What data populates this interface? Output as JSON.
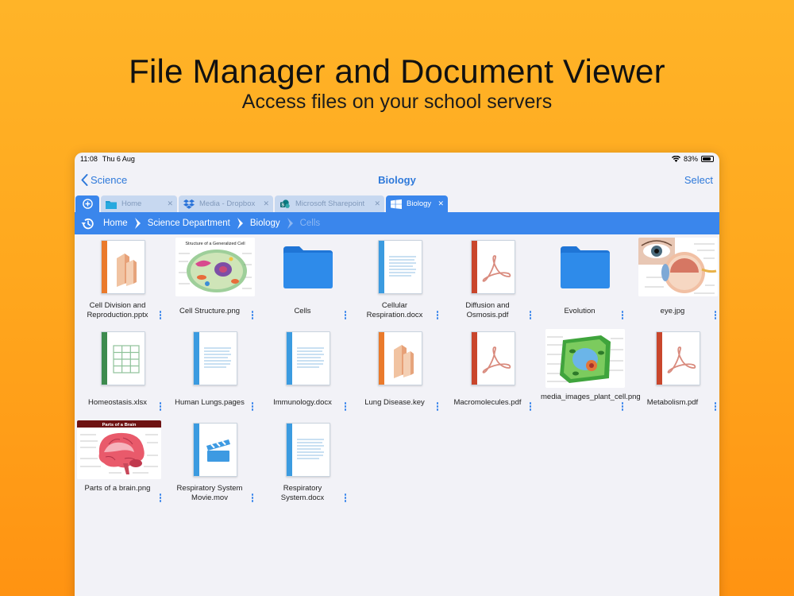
{
  "promo": {
    "headline": "File Manager and Document Viewer",
    "subline": "Access files on your school servers"
  },
  "status_bar": {
    "time": "11:08",
    "date": "Thu 6 Aug",
    "battery": "83%"
  },
  "nav": {
    "back_label": "Science",
    "title": "Biology",
    "select_label": "Select"
  },
  "tabs": [
    {
      "label": "Home",
      "icon": "folder-icon",
      "active": false
    },
    {
      "label": "Media - Dropbox",
      "icon": "dropbox-icon",
      "active": false
    },
    {
      "label": "Microsoft Sharepoint",
      "icon": "sharepoint-icon",
      "active": false
    },
    {
      "label": "Biology",
      "icon": "windows-icon",
      "active": true
    }
  ],
  "breadcrumb": [
    "Home",
    "Science Department",
    "Biology",
    "Cells"
  ],
  "files": [
    {
      "name": "Cell Division and Reproduction.pptx",
      "kind": "keynote"
    },
    {
      "name": "Cell Structure.png",
      "kind": "image-cell"
    },
    {
      "name": "Cells",
      "kind": "folder"
    },
    {
      "name": "Cellular Respiration.docx",
      "kind": "doc"
    },
    {
      "name": "Diffusion and Osmosis.pdf",
      "kind": "pdf"
    },
    {
      "name": "Evolution",
      "kind": "folder"
    },
    {
      "name": "eye.jpg",
      "kind": "image-eye"
    },
    {
      "name": "Homeostasis.xlsx",
      "kind": "sheet"
    },
    {
      "name": "Human Lungs.pages",
      "kind": "doc"
    },
    {
      "name": "Immunology.docx",
      "kind": "doc"
    },
    {
      "name": "Lung Disease.key",
      "kind": "keynote"
    },
    {
      "name": "Macromolecules.pdf",
      "kind": "pdf"
    },
    {
      "name": "media_images_plant_cell.png",
      "kind": "image-plant"
    },
    {
      "name": "Metabolism.pdf",
      "kind": "pdf"
    },
    {
      "name": "Parts of a brain.png",
      "kind": "image-brain"
    },
    {
      "name": "Respiratory System Movie.mov",
      "kind": "movie"
    },
    {
      "name": "Respiratory System.docx",
      "kind": "doc"
    }
  ],
  "image_labels": {
    "cell_structure_title": "Structure of a Generalized Cell",
    "brain_title": "Parts of a Brain"
  },
  "colors": {
    "accent": "#3A86EC",
    "tab_inactive": "#C7D8F0",
    "text_link": "#2E79DA",
    "keynote_orange": "#EA7A2B",
    "pdf_red": "#C9462C",
    "sheet_green": "#3D8B4E",
    "doc_blue": "#3B9BE0",
    "folder_blue": "#2E8BEA"
  }
}
